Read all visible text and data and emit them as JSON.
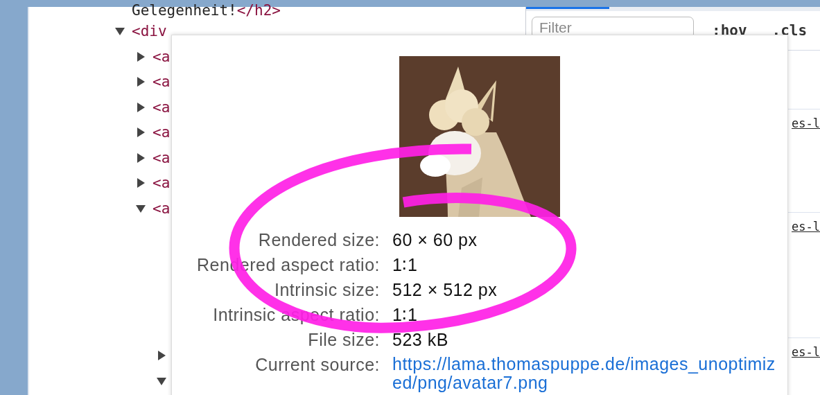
{
  "elements_tree": [
    {
      "kind": "text",
      "text": "Gelegenheit!",
      "tag": "</h2>"
    },
    {
      "kind": "element",
      "tag": "<div",
      "expanded": true,
      "children": [
        {
          "kind": "element",
          "tag": "<a",
          "expanded": false
        },
        {
          "kind": "element",
          "tag": "<a",
          "expanded": false
        },
        {
          "kind": "element",
          "tag": "<a",
          "expanded": false
        },
        {
          "kind": "element",
          "tag": "<a",
          "expanded": false
        },
        {
          "kind": "element",
          "tag": "<a",
          "expanded": false
        },
        {
          "kind": "element",
          "tag": "<a",
          "expanded": false
        },
        {
          "kind": "element",
          "tag": "<a",
          "expanded": true,
          "children": [
            {
              "kind": "element",
              "expanded": false
            },
            {
              "kind": "element",
              "expanded": true
            }
          ]
        }
      ]
    }
  ],
  "styles_panel": {
    "filter": {
      "placeholder": "Filter"
    },
    "toggles": [
      ":hov",
      ".cls"
    ],
    "rules": [
      {
        "text": "es-l"
      },
      {
        "text": "es-l"
      },
      {
        "text": "es-l"
      }
    ]
  },
  "image_tooltip": {
    "rows": [
      {
        "label": "Rendered size:",
        "value": "60 × 60 px",
        "kind": "text"
      },
      {
        "label": "Rendered aspect ratio:",
        "value": "1∶1",
        "kind": "text"
      },
      {
        "label": "Intrinsic size:",
        "value": "512 × 512 px",
        "kind": "text"
      },
      {
        "label": "Intrinsic aspect ratio:",
        "value": "1∶1",
        "kind": "text"
      },
      {
        "label": "File size:",
        "value": "523 kB",
        "kind": "text"
      },
      {
        "label": "Current source:",
        "value": "https://lama.thomaspuppe.de/images_unoptimized/png/avatar7.png",
        "kind": "link"
      }
    ]
  }
}
